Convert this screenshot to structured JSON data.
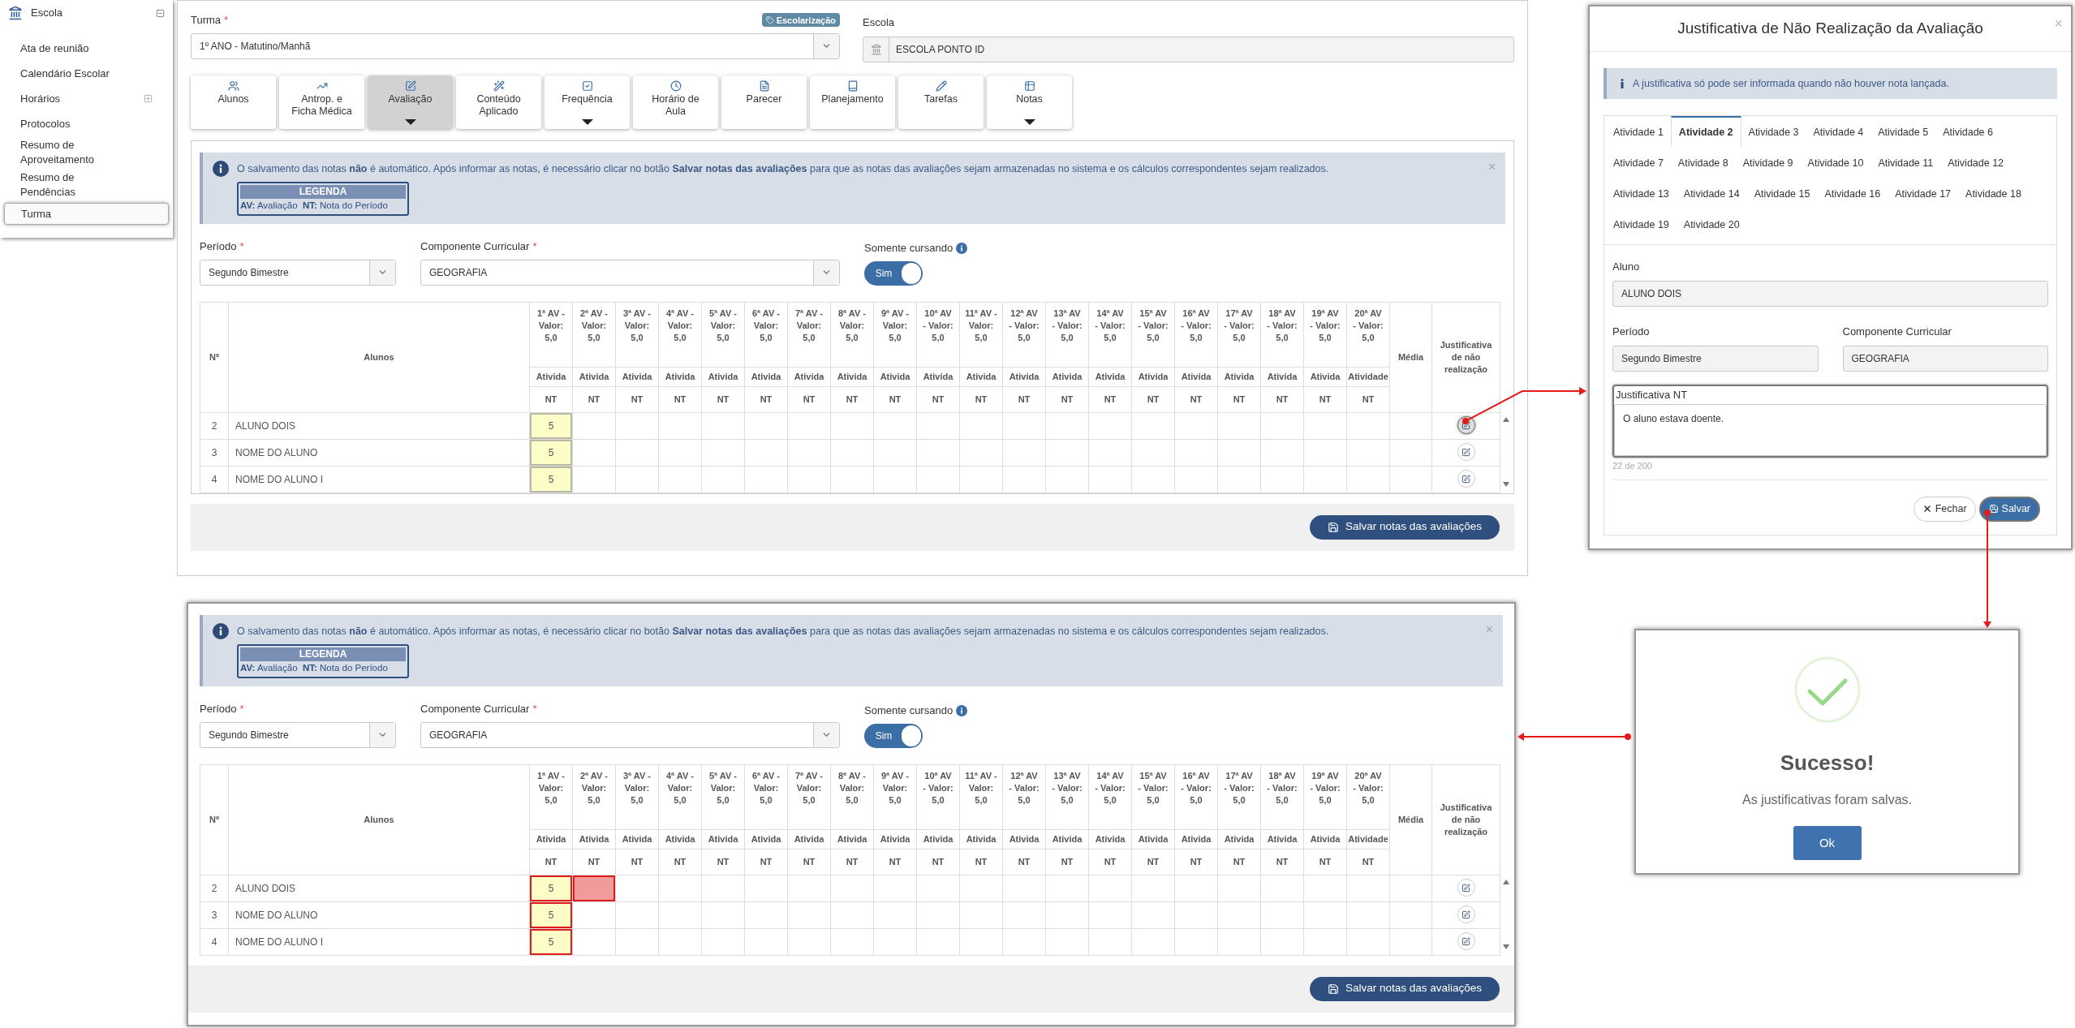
{
  "sidebar": {
    "section": {
      "label": "Escola",
      "expanded": true
    },
    "items": [
      {
        "label": "Ata de reunião",
        "kind": "link",
        "selected": false
      },
      {
        "label": "Calendário Escolar",
        "kind": "link",
        "selected": false
      },
      {
        "label": "Horários",
        "kind": "group",
        "selected": false
      },
      {
        "label": "Protocolos",
        "kind": "link",
        "selected": false
      },
      {
        "label": "Resumo de Aproveitamento",
        "kind": "link",
        "selected": false
      },
      {
        "label": "Resumo de Pendências",
        "kind": "link",
        "selected": false
      },
      {
        "label": "Turma",
        "kind": "link",
        "selected": true
      }
    ]
  },
  "top_panel": {
    "turma": {
      "label": "Turma",
      "required_mark": "*",
      "value": "1º ANO - Matutino/Manhã"
    },
    "badge": "Escolarização",
    "escola": {
      "label": "Escola",
      "value": "ESCOLA PONTO ID"
    },
    "tabs": [
      {
        "label": "Alunos",
        "selected": false,
        "has_menu": false
      },
      {
        "label": "Antrop. e Ficha Médica",
        "selected": false,
        "has_menu": false
      },
      {
        "label": "Avaliação",
        "selected": true,
        "has_menu": true
      },
      {
        "label": "Conteúdo Aplicado",
        "selected": false,
        "has_menu": false
      },
      {
        "label": "Frequência",
        "selected": false,
        "has_menu": true
      },
      {
        "label": "Horário de Aula",
        "selected": false,
        "has_menu": false
      },
      {
        "label": "Parecer",
        "selected": false,
        "has_menu": false
      },
      {
        "label": "Planejamento",
        "selected": false,
        "has_menu": false
      },
      {
        "label": "Tarefas",
        "selected": false,
        "has_menu": false
      },
      {
        "label": "Notas",
        "selected": false,
        "has_menu": true
      }
    ]
  },
  "grades_top": {
    "alert": {
      "text": "O salvamento das notas **não** é automático. Após informar as notas, é necessário clicar no botão **Salvar notas das avaliações** para que as notas das avaliações sejam armazenadas no sistema e os cálculos correspondentes sejam realizados.",
      "close": "×",
      "legend_title": "LEGENDA",
      "legend": "**AV:** Avaliação  **NT:** Nota do Período"
    },
    "periodo": {
      "label": "Período",
      "required_mark": "*",
      "value": "Segundo Bimestre"
    },
    "componente": {
      "label": "Componente Curricular",
      "required_mark": "*",
      "value": "GEOGRAFIA"
    },
    "somente_cursando": {
      "label": "Somente cursando",
      "toggle_label": "Sim",
      "on": true
    },
    "table": {
      "number": "Nº",
      "student": "Alunos",
      "average": "Média",
      "justification": "Justificativa de não realização",
      "assessments": [
        {
          "title": "1ª AV - Valor: 5,0",
          "activity": "Ativida",
          "grade": "NT"
        },
        {
          "title": "2ª AV - Valor: 5,0",
          "activity": "Ativida",
          "grade": "NT"
        },
        {
          "title": "3ª AV - Valor: 5,0",
          "activity": "Ativida",
          "grade": "NT"
        },
        {
          "title": "4ª AV - Valor: 5,0",
          "activity": "Ativida",
          "grade": "NT"
        },
        {
          "title": "5ª AV - Valor: 5,0",
          "activity": "Ativida",
          "grade": "NT"
        },
        {
          "title": "6ª AV - Valor: 5,0",
          "activity": "Ativida",
          "grade": "NT"
        },
        {
          "title": "7ª AV - Valor: 5,0",
          "activity": "Ativida",
          "grade": "NT"
        },
        {
          "title": "8ª AV - Valor: 5,0",
          "activity": "Ativida",
          "grade": "NT"
        },
        {
          "title": "9ª AV - Valor: 5,0",
          "activity": "Ativida",
          "grade": "NT"
        },
        {
          "title": "10ª AV - Valor: 5,0",
          "activity": "Ativida",
          "grade": "NT"
        },
        {
          "title": "11ª AV - Valor: 5,0",
          "activity": "Ativida",
          "grade": "NT"
        },
        {
          "title": "12ª AV - Valor: 5,0",
          "activity": "Ativida",
          "grade": "NT"
        },
        {
          "title": "13ª AV - Valor: 5,0",
          "activity": "Ativida",
          "grade": "NT"
        },
        {
          "title": "14ª AV - Valor: 5,0",
          "activity": "Ativida",
          "grade": "NT"
        },
        {
          "title": "15ª AV - Valor: 5,0",
          "activity": "Ativida",
          "grade": "NT"
        },
        {
          "title": "16ª AV - Valor: 5,0",
          "activity": "Ativida",
          "grade": "NT"
        },
        {
          "title": "17ª AV - Valor: 5,0",
          "activity": "Ativida",
          "grade": "NT"
        },
        {
          "title": "18ª AV - Valor: 5,0",
          "activity": "Ativida",
          "grade": "NT"
        },
        {
          "title": "19ª AV - Valor: 5,0",
          "activity": "Ativida",
          "grade": "NT"
        },
        {
          "title": "20ª AV - Valor: 5,0",
          "activity": "Atividade",
          "grade": "NT"
        }
      ],
      "rows": [
        {
          "number": "2",
          "name": "ALUNO DOIS",
          "cells": [
            {
              "value": "5",
              "highlighted": true,
              "flagged": false,
              "invalid": false
            }
          ],
          "justify_active": true
        },
        {
          "number": "3",
          "name": "NOME DO ALUNO",
          "cells": [
            {
              "value": "5",
              "highlighted": true,
              "flagged": false,
              "invalid": false
            }
          ],
          "justify_active": false
        },
        {
          "number": "4",
          "name": "NOME DO ALUNO I",
          "cells": [
            {
              "value": "5",
              "highlighted": true,
              "flagged": false,
              "invalid": false
            }
          ],
          "justify_active": false
        }
      ]
    },
    "save_button": "Salvar notas das avaliações"
  },
  "modal": {
    "title": "Justificativa de Não Realização da Avaliação",
    "close": "×",
    "info": "A justificativa só pode ser informada quando não houver nota lançada.",
    "tabs": [
      {
        "label": "Atividade 1",
        "selected": false
      },
      {
        "label": "Atividade 2",
        "selected": true
      },
      {
        "label": "Atividade 3",
        "selected": false
      },
      {
        "label": "Atividade 4",
        "selected": false
      },
      {
        "label": "Atividade 5",
        "selected": false
      },
      {
        "label": "Atividade 6",
        "selected": false
      },
      {
        "label": "Atividade 7",
        "selected": false
      },
      {
        "label": "Atividade 8",
        "selected": false
      },
      {
        "label": "Atividade 9",
        "selected": false
      },
      {
        "label": "Atividade 10",
        "selected": false
      },
      {
        "label": "Atividade 11",
        "selected": false
      },
      {
        "label": "Atividade 12",
        "selected": false
      },
      {
        "label": "Atividade 13",
        "selected": false
      },
      {
        "label": "Atividade 14",
        "selected": false
      },
      {
        "label": "Atividade 15",
        "selected": false
      },
      {
        "label": "Atividade 16",
        "selected": false
      },
      {
        "label": "Atividade 17",
        "selected": false
      },
      {
        "label": "Atividade 18",
        "selected": false
      },
      {
        "label": "Atividade 19",
        "selected": false
      },
      {
        "label": "Atividade 20",
        "selected": false
      }
    ],
    "aluno": {
      "label": "Aluno",
      "value": "ALUNO DOIS"
    },
    "periodo": {
      "label": "Período",
      "value": "Segundo Bimestre"
    },
    "componente": {
      "label": "Componente Curricular",
      "value": "GEOGRAFIA"
    },
    "justificativa": {
      "label": "Justificativa NT",
      "value": "O aluno estava doente.",
      "counter": "22 de 200"
    },
    "buttons": [
      {
        "label": "Fechar",
        "kind": "secondary"
      },
      {
        "label": "Salvar",
        "kind": "primary"
      }
    ]
  },
  "grades_bottom": {
    "alert": {
      "text": "O salvamento das notas **não** é automático. Após informar as notas, é necessário clicar no botão **Salvar notas das avaliações** para que as notas das avaliações sejam armazenadas no sistema e os cálculos correspondentes sejam realizados.",
      "close": "×",
      "legend_title": "LEGENDA",
      "legend": "**AV:** Avaliação  **NT:** Nota do Período"
    },
    "periodo": {
      "label": "Período",
      "required_mark": "*",
      "value": "Segundo Bimestre"
    },
    "componente": {
      "label": "Componente Curricular",
      "required_mark": "*",
      "value": "GEOGRAFIA"
    },
    "somente_cursando": {
      "label": "Somente cursando",
      "toggle_label": "Sim",
      "on": true
    },
    "table": {
      "number": "Nº",
      "student": "Alunos",
      "average": "Média",
      "justification": "Justificativa de não realização",
      "assessments": [
        {
          "title": "1ª AV - Valor: 5,0",
          "activity": "Ativida",
          "grade": "NT"
        },
        {
          "title": "2ª AV - Valor: 5,0",
          "activity": "Ativida",
          "grade": "NT"
        },
        {
          "title": "3ª AV - Valor: 5,0",
          "activity": "Ativida",
          "grade": "NT"
        },
        {
          "title": "4ª AV - Valor: 5,0",
          "activity": "Ativida",
          "grade": "NT"
        },
        {
          "title": "5ª AV - Valor: 5,0",
          "activity": "Ativida",
          "grade": "NT"
        },
        {
          "title": "6ª AV - Valor: 5,0",
          "activity": "Ativida",
          "grade": "NT"
        },
        {
          "title": "7ª AV - Valor: 5,0",
          "activity": "Ativida",
          "grade": "NT"
        },
        {
          "title": "8ª AV - Valor: 5,0",
          "activity": "Ativida",
          "grade": "NT"
        },
        {
          "title": "9ª AV - Valor: 5,0",
          "activity": "Ativida",
          "grade": "NT"
        },
        {
          "title": "10ª AV - Valor: 5,0",
          "activity": "Ativida",
          "grade": "NT"
        },
        {
          "title": "11ª AV - Valor: 5,0",
          "activity": "Ativida",
          "grade": "NT"
        },
        {
          "title": "12ª AV - Valor: 5,0",
          "activity": "Ativida",
          "grade": "NT"
        },
        {
          "title": "13ª AV - Valor: 5,0",
          "activity": "Ativida",
          "grade": "NT"
        },
        {
          "title": "14ª AV - Valor: 5,0",
          "activity": "Ativida",
          "grade": "NT"
        },
        {
          "title": "15ª AV - Valor: 5,0",
          "activity": "Ativida",
          "grade": "NT"
        },
        {
          "title": "16ª AV - Valor: 5,0",
          "activity": "Ativida",
          "grade": "NT"
        },
        {
          "title": "17ª AV - Valor: 5,0",
          "activity": "Ativida",
          "grade": "NT"
        },
        {
          "title": "18ª AV - Valor: 5,0",
          "activity": "Ativida",
          "grade": "NT"
        },
        {
          "title": "19ª AV - Valor: 5,0",
          "activity": "Ativida",
          "grade": "NT"
        },
        {
          "title": "20ª AV - Valor: 5,0",
          "activity": "Atividade",
          "grade": "NT"
        }
      ],
      "rows": [
        {
          "number": "2",
          "name": "ALUNO DOIS",
          "cells": [
            {
              "value": "5",
              "highlighted": true,
              "flagged": true,
              "invalid": false
            },
            {
              "highlighted": false,
              "flagged": true,
              "invalid": true
            }
          ],
          "justify_active": false
        },
        {
          "number": "3",
          "name": "NOME DO ALUNO",
          "cells": [
            {
              "value": "5",
              "highlighted": true,
              "flagged": true,
              "invalid": false
            }
          ],
          "justify_active": false
        },
        {
          "number": "4",
          "name": "NOME DO ALUNO I",
          "cells": [
            {
              "value": "5",
              "highlighted": true,
              "flagged": true,
              "invalid": false
            }
          ],
          "justify_active": false
        }
      ]
    },
    "save_button": "Salvar notas das avaliações"
  },
  "success": {
    "title": "Sucesso!",
    "message": "As justificativas foram salvas.",
    "button": "Ok"
  }
}
